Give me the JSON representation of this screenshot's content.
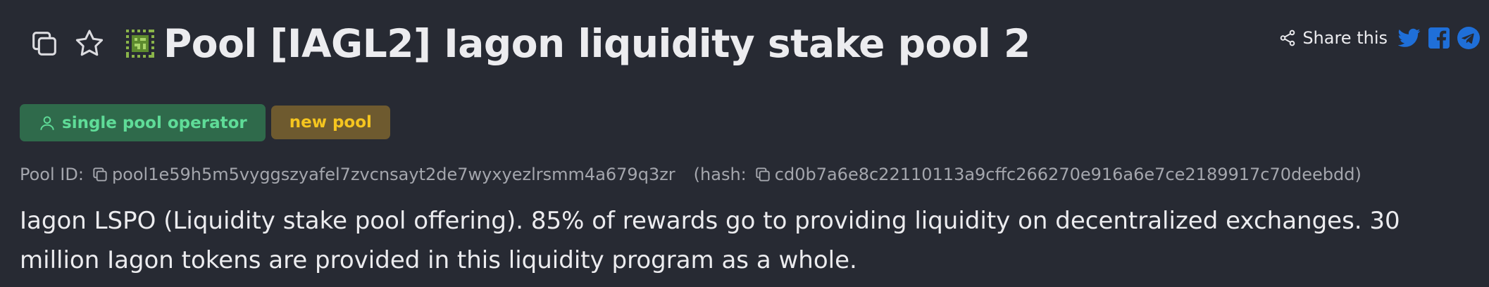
{
  "header": {
    "title": "Pool [IAGL2] Iagon liquidity stake pool 2",
    "copy_icon": "copy-icon",
    "star_icon": "star-icon",
    "logo": "pool-logo-icon"
  },
  "share": {
    "label": "Share this",
    "icons": [
      "share-icon",
      "twitter-icon",
      "facebook-icon",
      "telegram-icon"
    ],
    "social_color": "#1f6fd8"
  },
  "badges": {
    "operator": "single pool operator",
    "new": "new pool"
  },
  "ids": {
    "pool_id_label": "Pool ID:",
    "pool_id": "pool1e59h5m5vyggszyafel7zvcnsayt2de7wyxyezlrsmm4a679q3zr",
    "hash_open": "(hash:",
    "hash": "cd0b7a6e8c22110113a9cffc266270e916a6e7ce2189917c70deebdd",
    "hash_close": ")"
  },
  "description": "Iagon LSPO (Liquidity stake pool offering). 85% of rewards go to providing liquidity on decentralized exchanges. 30 million Iagon tokens are provided in this liquidity program as a whole.",
  "colors": {
    "background": "#272a33",
    "operator_badge_bg": "#2f6a4b",
    "operator_badge_text": "#5fdc98",
    "new_badge_bg": "#6e5a2f",
    "new_badge_text": "#f5c51f"
  }
}
